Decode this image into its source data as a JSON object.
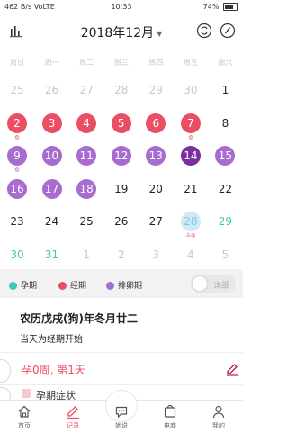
{
  "status_bar": {
    "left": "462 B/s VoLTE",
    "time": "10:33",
    "battery": "74%"
  },
  "header": {
    "month": "2018年12月",
    "icons": [
      "stats-icon",
      "sync-icon",
      "edit-circle-icon"
    ]
  },
  "weekdays": [
    "周日",
    "周一",
    "周二",
    "周三",
    "周四",
    "周五",
    "周六"
  ],
  "calendar": [
    [
      {
        "d": "25",
        "s": "muted"
      },
      {
        "d": "26",
        "s": "muted"
      },
      {
        "d": "27",
        "s": "muted"
      },
      {
        "d": "28",
        "s": "muted"
      },
      {
        "d": "29",
        "s": "muted"
      },
      {
        "d": "30",
        "s": "muted"
      },
      {
        "d": "1",
        "s": "normal"
      }
    ],
    [
      {
        "d": "2",
        "s": "period",
        "dots": "◍"
      },
      {
        "d": "3",
        "s": "period"
      },
      {
        "d": "4",
        "s": "period"
      },
      {
        "d": "5",
        "s": "period"
      },
      {
        "d": "6",
        "s": "period"
      },
      {
        "d": "7",
        "s": "period",
        "dots": "◍"
      },
      {
        "d": "8",
        "s": "normal"
      }
    ],
    [
      {
        "d": "9",
        "s": "ovu",
        "dots": "◍",
        "dotcolor": "purple"
      },
      {
        "d": "10",
        "s": "ovu"
      },
      {
        "d": "11",
        "s": "ovu"
      },
      {
        "d": "12",
        "s": "ovu"
      },
      {
        "d": "13",
        "s": "ovu"
      },
      {
        "d": "14",
        "s": "ovu-dark"
      },
      {
        "d": "15",
        "s": "ovu"
      }
    ],
    [
      {
        "d": "16",
        "s": "ovu"
      },
      {
        "d": "17",
        "s": "ovu"
      },
      {
        "d": "18",
        "s": "ovu"
      },
      {
        "d": "19",
        "s": "normal"
      },
      {
        "d": "20",
        "s": "normal"
      },
      {
        "d": "21",
        "s": "normal"
      },
      {
        "d": "22",
        "s": "normal"
      }
    ],
    [
      {
        "d": "23",
        "s": "normal"
      },
      {
        "d": "24",
        "s": "normal"
      },
      {
        "d": "25",
        "s": "normal"
      },
      {
        "d": "26",
        "s": "normal"
      },
      {
        "d": "27",
        "s": "normal"
      },
      {
        "d": "28",
        "s": "today",
        "dots": "♙◍"
      },
      {
        "d": "29",
        "s": "green"
      }
    ],
    [
      {
        "d": "30",
        "s": "green"
      },
      {
        "d": "31",
        "s": "green"
      },
      {
        "d": "1",
        "s": "muted"
      },
      {
        "d": "2",
        "s": "muted"
      },
      {
        "d": "3",
        "s": "muted"
      },
      {
        "d": "4",
        "s": "muted"
      },
      {
        "d": "5",
        "s": "muted"
      }
    ]
  ],
  "legend": {
    "items": [
      {
        "label": "孕期",
        "color": "#39c9b2"
      },
      {
        "label": "经期",
        "color": "#ea4e64"
      },
      {
        "label": "排卵期",
        "color": "#a86bcf"
      }
    ],
    "toggle_label": "详细"
  },
  "info": {
    "lunar": "农历戊戌(狗)年冬月廿二",
    "subtitle": "当天为经期开始"
  },
  "pregnancy": {
    "text": "孕0周, 第1天"
  },
  "symptom": {
    "text": "孕期症状"
  },
  "tabs": [
    {
      "label": "首页",
      "icon": "home-icon",
      "active": false
    },
    {
      "label": "记录",
      "icon": "pencil-icon",
      "active": true
    },
    {
      "label": "她说",
      "icon": "chat-icon",
      "active": false
    },
    {
      "label": "电商",
      "icon": "shop-icon",
      "active": false
    },
    {
      "label": "我的",
      "icon": "user-icon",
      "active": false
    }
  ]
}
